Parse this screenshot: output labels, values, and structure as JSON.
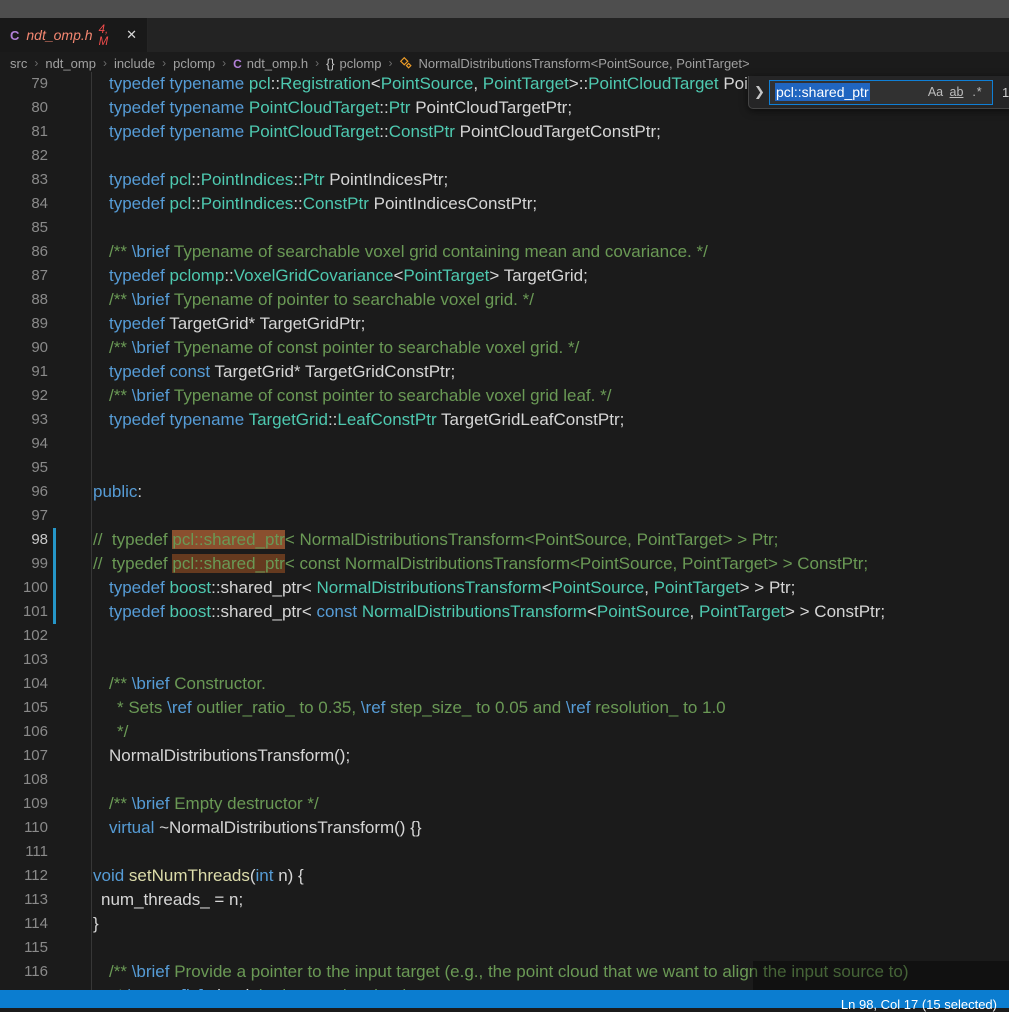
{
  "tab": {
    "language_badge": "C",
    "filename": "ndt_omp.h",
    "decoration": "4, M",
    "close_glyph": "✕"
  },
  "breadcrumbs": [
    {
      "label": "src"
    },
    {
      "label": "ndt_omp"
    },
    {
      "label": "include"
    },
    {
      "label": "pclomp"
    },
    {
      "label": "ndt_omp.h",
      "icon": "c-language-icon"
    },
    {
      "label": "pclomp",
      "icon": "braces-namespace-icon",
      "icon_glyph": "{}"
    },
    {
      "label": "NormalDistributionsTransform<PointSource, PointTarget>",
      "icon": "class-symbol-icon"
    }
  ],
  "find": {
    "query": "pcl::shared_ptr",
    "chevron_glyph": "❯",
    "match_case_label": "Aa",
    "whole_word_label": "ab",
    "regex_label": ".*",
    "match_count": "1"
  },
  "editor": {
    "lines": [
      {
        "n": 79,
        "ind": 49,
        "tok": [
          [
            "k",
            "typedef typename "
          ],
          [
            "t",
            "pcl"
          ],
          [
            "p",
            "::"
          ],
          [
            "t",
            "Registration"
          ],
          [
            "p",
            "<"
          ],
          [
            "t",
            "PointSource"
          ],
          [
            "p",
            ", "
          ],
          [
            "t",
            "PointTarget"
          ],
          [
            "p",
            ">::"
          ],
          [
            "t",
            "PointCloudTarget"
          ],
          [
            "p",
            " PointCloudTarget;"
          ]
        ]
      },
      {
        "n": 80,
        "ind": 49,
        "tok": [
          [
            "k",
            "typedef typename "
          ],
          [
            "t",
            "PointCloudTarget"
          ],
          [
            "p",
            "::"
          ],
          [
            "t",
            "Ptr"
          ],
          [
            "p",
            " PointCloudTargetPtr;"
          ]
        ]
      },
      {
        "n": 81,
        "ind": 49,
        "tok": [
          [
            "k",
            "typedef typename "
          ],
          [
            "t",
            "PointCloudTarget"
          ],
          [
            "p",
            "::"
          ],
          [
            "t",
            "ConstPtr"
          ],
          [
            "p",
            " PointCloudTargetConstPtr;"
          ]
        ]
      },
      {
        "n": 82,
        "ind": 0,
        "tok": []
      },
      {
        "n": 83,
        "ind": 49,
        "tok": [
          [
            "k",
            "typedef "
          ],
          [
            "t",
            "pcl"
          ],
          [
            "p",
            "::"
          ],
          [
            "t",
            "PointIndices"
          ],
          [
            "p",
            "::"
          ],
          [
            "t",
            "Ptr"
          ],
          [
            "p",
            " PointIndicesPtr;"
          ]
        ]
      },
      {
        "n": 84,
        "ind": 49,
        "tok": [
          [
            "k",
            "typedef "
          ],
          [
            "t",
            "pcl"
          ],
          [
            "p",
            "::"
          ],
          [
            "t",
            "PointIndices"
          ],
          [
            "p",
            "::"
          ],
          [
            "t",
            "ConstPtr"
          ],
          [
            "p",
            " PointIndicesConstPtr;"
          ]
        ]
      },
      {
        "n": 85,
        "ind": 0,
        "tok": []
      },
      {
        "n": 86,
        "ind": 49,
        "tok": [
          [
            "c",
            "/** "
          ],
          [
            "d",
            "\\brief"
          ],
          [
            "c",
            " Typename of searchable voxel grid containing mean and covariance. */"
          ]
        ]
      },
      {
        "n": 87,
        "ind": 49,
        "tok": [
          [
            "k",
            "typedef "
          ],
          [
            "t",
            "pclomp"
          ],
          [
            "p",
            "::"
          ],
          [
            "t",
            "VoxelGridCovariance"
          ],
          [
            "p",
            "<"
          ],
          [
            "t",
            "PointTarget"
          ],
          [
            "p",
            "> TargetGrid;"
          ]
        ]
      },
      {
        "n": 88,
        "ind": 49,
        "tok": [
          [
            "c",
            "/** "
          ],
          [
            "d",
            "\\brief"
          ],
          [
            "c",
            " Typename of pointer to searchable voxel grid. */"
          ]
        ]
      },
      {
        "n": 89,
        "ind": 49,
        "tok": [
          [
            "k",
            "typedef "
          ],
          [
            "p",
            "TargetGrid* TargetGridPtr;"
          ]
        ]
      },
      {
        "n": 90,
        "ind": 49,
        "tok": [
          [
            "c",
            "/** "
          ],
          [
            "d",
            "\\brief"
          ],
          [
            "c",
            " Typename of const pointer to searchable voxel grid. */"
          ]
        ]
      },
      {
        "n": 91,
        "ind": 49,
        "tok": [
          [
            "k",
            "typedef const "
          ],
          [
            "p",
            "TargetGrid* TargetGridConstPtr;"
          ]
        ]
      },
      {
        "n": 92,
        "ind": 49,
        "tok": [
          [
            "c",
            "/** "
          ],
          [
            "d",
            "\\brief"
          ],
          [
            "c",
            " Typename of const pointer to searchable voxel grid leaf. */"
          ]
        ]
      },
      {
        "n": 93,
        "ind": 49,
        "tok": [
          [
            "k",
            "typedef typename "
          ],
          [
            "t",
            "TargetGrid"
          ],
          [
            "p",
            "::"
          ],
          [
            "t",
            "LeafConstPtr"
          ],
          [
            "p",
            " TargetGridLeafConstPtr;"
          ]
        ]
      },
      {
        "n": 94,
        "ind": 0,
        "tok": []
      },
      {
        "n": 95,
        "ind": 0,
        "tok": []
      },
      {
        "n": 96,
        "ind": 33,
        "tok": [
          [
            "k",
            "public"
          ],
          [
            "p",
            ":"
          ]
        ]
      },
      {
        "n": 97,
        "ind": 0,
        "tok": []
      },
      {
        "n": 98,
        "ind": 33,
        "active": true,
        "git": true,
        "tok": [
          [
            "c",
            "//  typedef "
          ],
          [
            "cM",
            "pcl::shared_ptr"
          ],
          [
            "c",
            "< NormalDistributionsTransform<PointSource, PointTarget> > Ptr;"
          ]
        ]
      },
      {
        "n": 99,
        "ind": 33,
        "git": true,
        "tok": [
          [
            "c",
            "//  typedef "
          ],
          [
            "cm",
            "pcl::shared_ptr"
          ],
          [
            "c",
            "< const NormalDistributionsTransform<PointSource, PointTarget> > ConstPtr;"
          ]
        ]
      },
      {
        "n": 100,
        "ind": 49,
        "git": true,
        "tok": [
          [
            "k",
            "typedef "
          ],
          [
            "t",
            "boost"
          ],
          [
            "p",
            "::shared_ptr< "
          ],
          [
            "t",
            "NormalDistributionsTransform"
          ],
          [
            "p",
            "<"
          ],
          [
            "t",
            "PointSource"
          ],
          [
            "p",
            ", "
          ],
          [
            "t",
            "PointTarget"
          ],
          [
            "p",
            "> > Ptr;"
          ]
        ]
      },
      {
        "n": 101,
        "ind": 49,
        "git": true,
        "tok": [
          [
            "k",
            "typedef "
          ],
          [
            "t",
            "boost"
          ],
          [
            "p",
            "::shared_ptr< "
          ],
          [
            "k",
            "const "
          ],
          [
            "t",
            "NormalDistributionsTransform"
          ],
          [
            "p",
            "<"
          ],
          [
            "t",
            "PointSource"
          ],
          [
            "p",
            ", "
          ],
          [
            "t",
            "PointTarget"
          ],
          [
            "p",
            "> > ConstPtr;"
          ]
        ]
      },
      {
        "n": 102,
        "ind": 0,
        "tok": []
      },
      {
        "n": 103,
        "ind": 0,
        "tok": []
      },
      {
        "n": 104,
        "ind": 49,
        "tok": [
          [
            "c",
            "/** "
          ],
          [
            "d",
            "\\brief"
          ],
          [
            "c",
            " Constructor."
          ]
        ]
      },
      {
        "n": 105,
        "ind": 57,
        "tok": [
          [
            "c",
            "* Sets "
          ],
          [
            "d",
            "\\ref"
          ],
          [
            "c",
            " outlier_ratio_ to 0.35, "
          ],
          [
            "d",
            "\\ref"
          ],
          [
            "c",
            " step_size_ to 0.05 and "
          ],
          [
            "d",
            "\\ref"
          ],
          [
            "c",
            " resolution_ to 1.0"
          ]
        ]
      },
      {
        "n": 106,
        "ind": 57,
        "tok": [
          [
            "c",
            "*/"
          ]
        ]
      },
      {
        "n": 107,
        "ind": 49,
        "tok": [
          [
            "p",
            "NormalDistributionsTransform();"
          ]
        ]
      },
      {
        "n": 108,
        "ind": 0,
        "tok": []
      },
      {
        "n": 109,
        "ind": 49,
        "tok": [
          [
            "c",
            "/** "
          ],
          [
            "d",
            "\\brief"
          ],
          [
            "c",
            " Empty destructor */"
          ]
        ]
      },
      {
        "n": 110,
        "ind": 49,
        "tok": [
          [
            "k",
            "virtual "
          ],
          [
            "p",
            "~NormalDistributionsTransform() {}"
          ]
        ]
      },
      {
        "n": 111,
        "ind": 0,
        "tok": []
      },
      {
        "n": 112,
        "ind": 33,
        "tok": [
          [
            "k",
            "void "
          ],
          [
            "f",
            "setNumThreads"
          ],
          [
            "p",
            "("
          ],
          [
            "k",
            "int"
          ],
          [
            "p",
            " n) {"
          ]
        ]
      },
      {
        "n": 113,
        "ind": 41,
        "tok": [
          [
            "p",
            "num_threads_ = n;"
          ]
        ]
      },
      {
        "n": 114,
        "ind": 33,
        "tok": [
          [
            "p",
            "}"
          ]
        ]
      },
      {
        "n": 115,
        "ind": 0,
        "tok": []
      },
      {
        "n": 116,
        "ind": 49,
        "tok": [
          [
            "c",
            "/** "
          ],
          [
            "d",
            "\\brief"
          ],
          [
            "c",
            " Provide a pointer to the input target (e.g., the point cloud that we want to align the input source to)"
          ]
        ]
      },
      {
        "n": 117,
        "ind": 57,
        "tok": [
          [
            "c",
            "* "
          ],
          [
            "d",
            "\\param[in]"
          ],
          [
            "c",
            " "
          ],
          [
            "w",
            "cloud"
          ],
          [
            "c",
            " the input point cloud target"
          ]
        ]
      }
    ]
  },
  "status": {
    "cursor_position": "Ln 98, Col 17 (15 selected)"
  },
  "colors": {
    "status_bar": "#0b7dd0",
    "keyword": "#569CD6",
    "type": "#4EC9B0",
    "comment": "#6A9955",
    "function": "#DCDCAA",
    "find_match_current": "#8a4f2e",
    "find_match_other": "#653a1f",
    "git_modified_bar": "#2596c8",
    "tab_error_label": "#f48771",
    "tab_problems": "#f14c4c",
    "class_icon": "#ee9d28",
    "input_selection": "#2065c0"
  }
}
